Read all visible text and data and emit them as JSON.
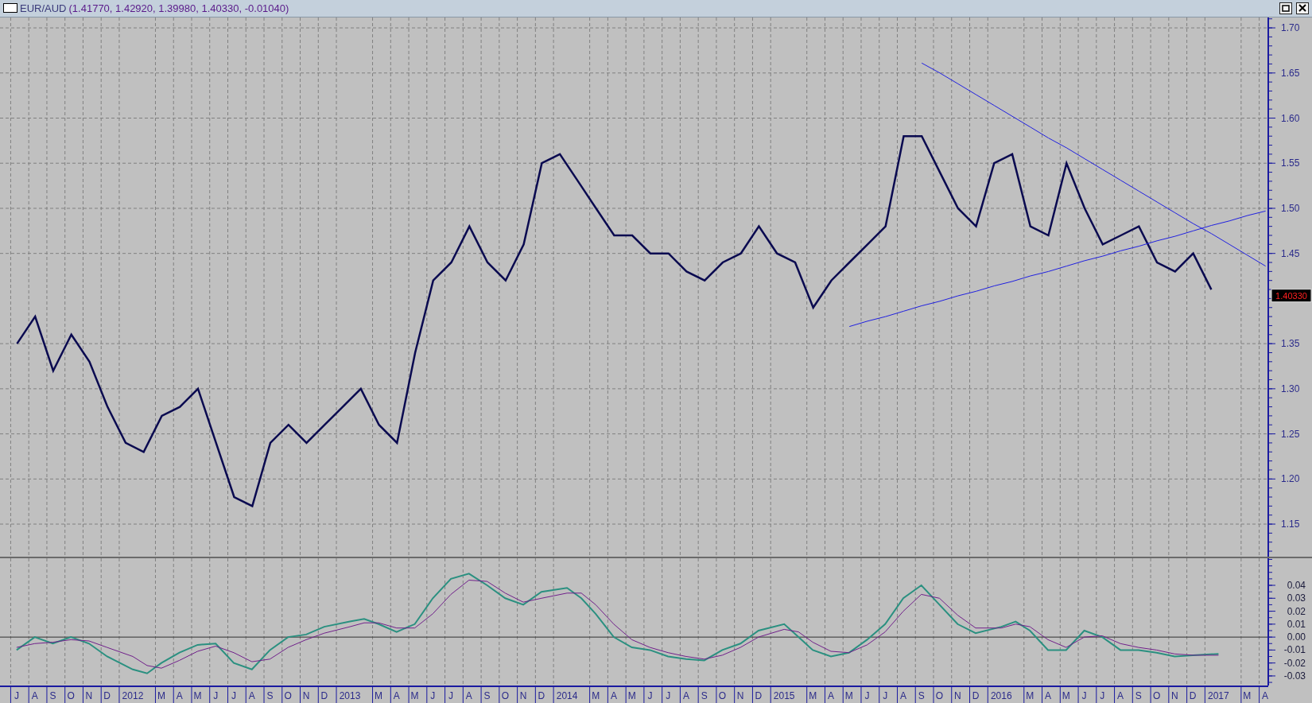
{
  "window": {
    "symbol": "EUR/AUD",
    "values": "(1.41770, 1.42920, 1.39980, 1.40330, -0.01040)"
  },
  "price_pane": {
    "last_price": "1.40330",
    "chart_data": {
      "type": "line",
      "categories": [
        null,
        null,
        null,
        null,
        null,
        null,
        null,
        null,
        null,
        null,
        null,
        null,
        null,
        null,
        null,
        null,
        null,
        null,
        null,
        null,
        null,
        null,
        null,
        null,
        null,
        null,
        null,
        null,
        null,
        null,
        null,
        null,
        null,
        null,
        null,
        null,
        null,
        null,
        null,
        null,
        null,
        null,
        null,
        null,
        null,
        null,
        null,
        null,
        null,
        null,
        null,
        null,
        null,
        null,
        null,
        null,
        null,
        null,
        null,
        null,
        null,
        null,
        null,
        null,
        null,
        null,
        null,
        null,
        null,
        null
      ],
      "series": [
        {
          "color": "#0a0a50",
          "values": [
            1.35,
            1.38,
            1.32,
            1.36,
            1.33,
            1.28,
            1.24,
            1.23,
            1.27,
            1.28,
            1.3,
            1.24,
            1.18,
            1.17,
            1.24,
            1.26,
            1.24,
            1.26,
            1.28,
            1.3,
            1.26,
            1.24,
            1.34,
            1.42,
            1.44,
            1.48,
            1.44,
            1.42,
            1.46,
            1.55,
            1.56,
            1.53,
            1.5,
            1.47,
            1.47,
            1.45,
            1.45,
            1.43,
            1.42,
            1.44,
            1.45,
            1.48,
            1.45,
            1.44,
            1.39,
            1.42,
            1.44,
            1.46,
            1.48,
            1.58,
            1.58,
            1.54,
            1.5,
            1.48,
            1.55,
            1.56,
            1.48,
            1.47,
            1.55,
            1.5,
            1.46,
            1.47,
            1.48,
            1.44,
            1.43,
            1.45,
            1.41,
            null,
            null,
            null
          ]
        },
        {
          "color": "#2020e0",
          "values": [
            null,
            null,
            null,
            null,
            null,
            null,
            null,
            null,
            null,
            null,
            null,
            null,
            null,
            null,
            null,
            null,
            null,
            null,
            null,
            null,
            null,
            null,
            null,
            null,
            null,
            null,
            null,
            null,
            null,
            null,
            null,
            null,
            null,
            null,
            null,
            null,
            null,
            null,
            null,
            null,
            null,
            null,
            null,
            null,
            null,
            null,
            null,
            null,
            null,
            null,
            1.661,
            1.65,
            1.638,
            1.626,
            1.614,
            1.602,
            1.59,
            1.578,
            1.567,
            1.555,
            1.543,
            1.531,
            1.519,
            1.507,
            1.495,
            1.483,
            1.472,
            1.46,
            1.448,
            1.436
          ]
        },
        {
          "color": "#2020e0",
          "values": [
            null,
            null,
            null,
            null,
            null,
            null,
            null,
            null,
            null,
            null,
            null,
            null,
            null,
            null,
            null,
            null,
            null,
            null,
            null,
            null,
            null,
            null,
            null,
            null,
            null,
            null,
            null,
            null,
            null,
            null,
            null,
            null,
            null,
            null,
            null,
            null,
            null,
            null,
            null,
            null,
            null,
            null,
            null,
            null,
            null,
            null,
            1.369,
            1.375,
            1.38,
            1.386,
            1.392,
            1.397,
            1.403,
            1.408,
            1.414,
            1.419,
            1.425,
            1.43,
            1.436,
            1.442,
            1.447,
            1.453,
            1.458,
            1.464,
            1.469,
            1.475,
            1.481,
            1.486,
            1.492,
            1.497
          ]
        }
      ],
      "ylim": [
        1.1139,
        1.7115
      ],
      "grid": true,
      "yticks": [
        {
          "value": 1.15,
          "label": "1.15"
        },
        {
          "value": 1.2,
          "label": "1.20"
        },
        {
          "value": 1.25,
          "label": "1.25"
        },
        {
          "value": 1.3,
          "label": "1.30"
        },
        {
          "value": 1.35,
          "label": "1.35"
        },
        {
          "value": 1.45,
          "label": "1.45"
        },
        {
          "value": 1.5,
          "label": "1.50"
        },
        {
          "value": 1.55,
          "label": "1.55"
        },
        {
          "value": 1.6,
          "label": "1.60"
        },
        {
          "value": 1.65,
          "label": "1.65"
        },
        {
          "value": 1.7,
          "label": "1.70"
        }
      ]
    }
  },
  "indicator_pane": {
    "chart_data": {
      "type": "line",
      "categories": [
        "J",
        "A",
        "S",
        "O",
        "N",
        "D",
        "2012",
        null,
        "M",
        "A",
        "M",
        "J",
        "J",
        "A",
        "S",
        "O",
        "N",
        "D",
        "2013",
        null,
        "M",
        "A",
        "M",
        "J",
        "J",
        "A",
        "S",
        "O",
        "N",
        "D",
        "2014",
        null,
        "M",
        "A",
        "M",
        "J",
        "J",
        "A",
        "S",
        "O",
        "N",
        "D",
        "2015",
        null,
        "M",
        "A",
        "M",
        "J",
        "J",
        "A",
        "S",
        "O",
        "N",
        "D",
        "2016",
        null,
        "M",
        "A",
        "M",
        "J",
        "J",
        "A",
        "S",
        "O",
        "N",
        "D",
        "2017",
        null,
        "M",
        "A"
      ],
      "series": [
        {
          "color": "#2a9080",
          "values": [
            -0.01,
            0.0,
            -0.005,
            0.0,
            -0.005,
            -0.015,
            -0.025,
            -0.028,
            -0.02,
            -0.012,
            -0.006,
            -0.005,
            -0.02,
            -0.025,
            -0.01,
            0.0,
            0.002,
            0.008,
            0.012,
            0.014,
            0.01,
            0.004,
            0.01,
            0.03,
            0.045,
            0.049,
            0.04,
            0.03,
            0.025,
            0.035,
            0.038,
            0.03,
            0.018,
            0.0,
            -0.008,
            -0.01,
            -0.015,
            -0.017,
            -0.018,
            -0.01,
            -0.005,
            0.005,
            0.01,
            0.0,
            -0.01,
            -0.015,
            -0.012,
            -0.002,
            0.01,
            0.03,
            0.04,
            0.025,
            0.01,
            0.003,
            0.008,
            0.012,
            0.005,
            -0.01,
            -0.01,
            0.005,
            0.0,
            -0.01,
            -0.01,
            -0.012,
            -0.015,
            -0.014,
            -0.013,
            null,
            null,
            null
          ]
        },
        {
          "color": "#70208a",
          "values": [
            -0.008,
            -0.005,
            -0.004,
            -0.002,
            -0.003,
            -0.008,
            -0.015,
            -0.022,
            -0.024,
            -0.018,
            -0.011,
            -0.007,
            -0.012,
            -0.019,
            -0.017,
            -0.008,
            -0.002,
            0.003,
            0.008,
            0.011,
            0.011,
            0.007,
            0.007,
            0.018,
            0.033,
            0.044,
            0.043,
            0.034,
            0.027,
            0.03,
            0.034,
            0.034,
            0.025,
            0.01,
            -0.002,
            -0.008,
            -0.012,
            -0.015,
            -0.017,
            -0.014,
            -0.008,
            0.0,
            0.006,
            0.004,
            -0.004,
            -0.011,
            -0.012,
            -0.006,
            0.004,
            0.02,
            0.033,
            0.03,
            0.017,
            0.007,
            0.007,
            0.01,
            0.008,
            -0.002,
            -0.008,
            0.0,
            0.001,
            -0.005,
            -0.008,
            -0.01,
            -0.013,
            -0.014,
            -0.014,
            null,
            null,
            null
          ]
        }
      ],
      "ylim": [
        -0.0374,
        0.0609
      ],
      "grid": true,
      "yticks": [
        {
          "value": -0.03,
          "label": "-0.03"
        },
        {
          "value": -0.02,
          "label": "-0.02"
        },
        {
          "value": -0.01,
          "label": "-0.01"
        },
        {
          "value": 0,
          "label": "0.00"
        },
        {
          "value": 0.01,
          "label": "0.01"
        },
        {
          "value": 0.02,
          "label": "0.02"
        },
        {
          "value": 0.03,
          "label": "0.03"
        },
        {
          "value": 0.04,
          "label": "0.04"
        }
      ]
    }
  }
}
